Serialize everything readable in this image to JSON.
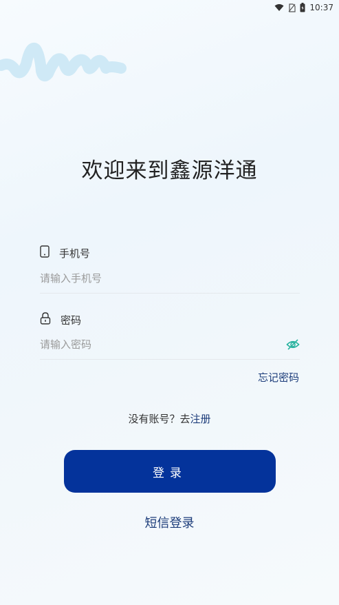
{
  "status_bar": {
    "time": "10:37",
    "icons": [
      "wifi-icon",
      "no-sim-icon",
      "battery-icon"
    ]
  },
  "header": {
    "welcome": "欢迎来到鑫源洋通"
  },
  "form": {
    "phone": {
      "label": "手机号",
      "placeholder": "请输入手机号",
      "value": "",
      "icon": "phone-icon"
    },
    "password": {
      "label": "密码",
      "placeholder": "请输入密码",
      "value": "",
      "icon": "lock-icon",
      "toggle_icon": "eye-icon"
    },
    "forgot_label": "忘记密码"
  },
  "register": {
    "prompt": "没有账号？去",
    "link": "注册"
  },
  "actions": {
    "login_label": "登录",
    "sms_login_label": "短信登录"
  },
  "colors": {
    "primary": "#04339b",
    "link": "#1c3c7a",
    "eye_icon": "#2ab3a0"
  }
}
